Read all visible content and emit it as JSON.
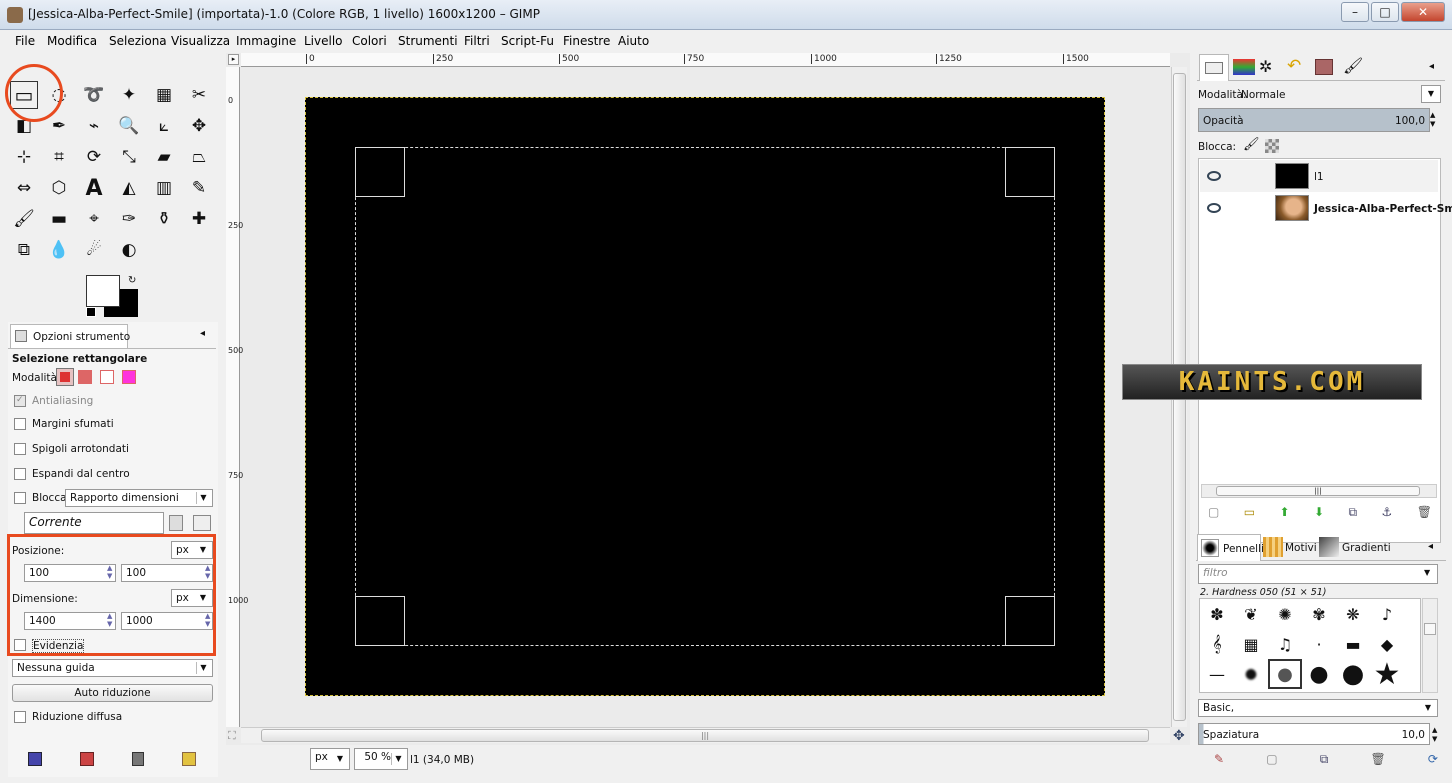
{
  "window": {
    "title": "[Jessica-Alba-Perfect-Smile] (importata)-1.0 (Colore RGB, 1 livello) 1600x1200 – GIMP",
    "controls": [
      "–",
      "□",
      "✕"
    ]
  },
  "menubar": [
    "File",
    "Modifica",
    "Seleziona",
    "Visualizza",
    "Immagine",
    "Livello",
    "Colori",
    "Strumenti",
    "Filtri",
    "Script-Fu",
    "Finestre",
    "Aiuto"
  ],
  "tools": [
    {
      "name": "rect-select-icon",
      "glyph": "▭"
    },
    {
      "name": "ellipse-select-icon",
      "glyph": "◌"
    },
    {
      "name": "free-select-icon",
      "glyph": "➰"
    },
    {
      "name": "fuzzy-select-icon",
      "glyph": "✦"
    },
    {
      "name": "color-select-icon",
      "glyph": "▦"
    },
    {
      "name": "scissors-icon",
      "glyph": "✂"
    },
    {
      "name": "foreground-select-icon",
      "glyph": "◧"
    },
    {
      "name": "paths-icon",
      "glyph": "✒"
    },
    {
      "name": "color-picker-icon",
      "glyph": "⌁"
    },
    {
      "name": "zoom-icon",
      "glyph": "🔍"
    },
    {
      "name": "measure-icon",
      "glyph": "⟀"
    },
    {
      "name": "move-icon",
      "glyph": "✥"
    },
    {
      "name": "align-icon",
      "glyph": "⊹"
    },
    {
      "name": "crop-icon",
      "glyph": "⌗"
    },
    {
      "name": "rotate-icon",
      "glyph": "⟳"
    },
    {
      "name": "scale-icon",
      "glyph": "⤡"
    },
    {
      "name": "shear-icon",
      "glyph": "▰"
    },
    {
      "name": "perspective-icon",
      "glyph": "⏢"
    },
    {
      "name": "flip-icon",
      "glyph": "⇔"
    },
    {
      "name": "cage-icon",
      "glyph": "⬡"
    },
    {
      "name": "text-icon",
      "glyph": "A"
    },
    {
      "name": "bucket-fill-icon",
      "glyph": "◭"
    },
    {
      "name": "blend-icon",
      "glyph": "▥"
    },
    {
      "name": "pencil-icon",
      "glyph": "✎"
    },
    {
      "name": "paintbrush-icon",
      "glyph": "🖌"
    },
    {
      "name": "eraser-icon",
      "glyph": "▬"
    },
    {
      "name": "airbrush-icon",
      "glyph": "⌖"
    },
    {
      "name": "ink-icon",
      "glyph": "✑"
    },
    {
      "name": "clone-icon",
      "glyph": "⚱"
    },
    {
      "name": "heal-icon",
      "glyph": "✚"
    },
    {
      "name": "perspective-clone-icon",
      "glyph": "⧉"
    },
    {
      "name": "blur-icon",
      "glyph": "💧"
    },
    {
      "name": "smudge-icon",
      "glyph": "☄"
    },
    {
      "name": "dodge-burn-icon",
      "glyph": "◐"
    }
  ],
  "tool_options": {
    "tab_label": "Opzioni strumento",
    "title": "Selezione rettangolare",
    "mode_label": "Modalità:",
    "antialiasing": "Antialiasing",
    "feather": "Margini sfumati",
    "rounded": "Spigoli arrotondati",
    "expand": "Espandi dal centro",
    "fixed_label": "Blocca:",
    "fixed_value": "Rapporto dimensioni",
    "current": "Corrente",
    "position_label": "Posizione:",
    "position_unit": "px",
    "pos_x": "100",
    "pos_y": "100",
    "size_label": "Dimensione:",
    "size_unit": "px",
    "size_w": "1400",
    "size_h": "1000",
    "highlight": "Evidenzia",
    "guides": "Nessuna guida",
    "autoshrink": "Auto riduzione",
    "shrink_merged": "Riduzione diffusa"
  },
  "rulers": {
    "h": [
      "0",
      "250",
      "500",
      "750",
      "1000",
      "1250",
      "1500"
    ],
    "v": [
      "0",
      "250",
      "500",
      "750",
      "1000"
    ]
  },
  "status": {
    "unit": "px",
    "zoom": "50 %",
    "info": "l1 (34,0 MB)"
  },
  "layers_panel": {
    "mode_label": "Modalità:",
    "mode_value": "Normale",
    "opacity_label": "Opacità",
    "opacity_value": "100,0",
    "lock_label": "Blocca:",
    "layers": [
      {
        "name": "l1"
      },
      {
        "name": "Jessica-Alba-Perfect-Smile."
      }
    ]
  },
  "brushes_panel": {
    "tabs": [
      "Pennelli",
      "Motivi",
      "Gradienti"
    ],
    "filter_placeholder": "filtro",
    "brush_name": "2. Hardness 050 (51 × 51)",
    "tag": "Basic,",
    "spacing_label": "Spaziatura",
    "spacing_value": "10,0"
  },
  "watermark": "KAINTS.COM",
  "colors": {
    "accent": "#e84a1f",
    "canvas": "#000000"
  }
}
